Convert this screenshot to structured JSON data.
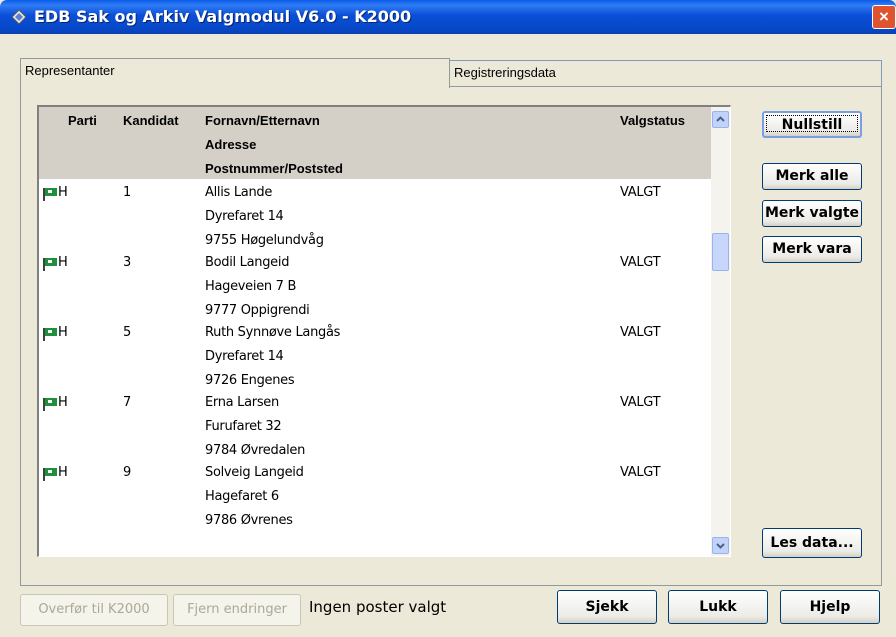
{
  "window": {
    "title": "EDB Sak og Arkiv Valgmodul V6.0 - K2000",
    "close_glyph": "×"
  },
  "tabs": [
    {
      "label": "Representanter",
      "active": true
    },
    {
      "label": "Registreringsdata",
      "active": false
    }
  ],
  "list": {
    "columns": {
      "parti": "Parti",
      "kandidat": "Kandidat",
      "name": "Fornavn/Etternavn",
      "address": "Adresse",
      "postal": "Postnummer/Poststed",
      "status": "Valgstatus"
    },
    "rows": [
      {
        "parti": "H",
        "kandidat": "1",
        "name": "Allis Lande",
        "address": "Dyrefaret 14",
        "postal": "9755 Høgelundvåg",
        "status": "VALGT"
      },
      {
        "parti": "H",
        "kandidat": "3",
        "name": "Bodil Langeid",
        "address": "Hageveien 7 B",
        "postal": "9777 Oppigrendi",
        "status": "VALGT"
      },
      {
        "parti": "H",
        "kandidat": "5",
        "name": "Ruth Synnøve Langås",
        "address": "Dyrefaret 14",
        "postal": "9726 Engenes",
        "status": "VALGT"
      },
      {
        "parti": "H",
        "kandidat": "7",
        "name": "Erna Larsen",
        "address": "Furufaret 32",
        "postal": "9784 Øvredalen",
        "status": "VALGT"
      },
      {
        "parti": "H",
        "kandidat": "9",
        "name": "Solveig Langeid",
        "address": "Hagefaret 6",
        "postal": "9786 Øvrenes",
        "status": "VALGT"
      }
    ]
  },
  "side_buttons": {
    "nullstill": "Nullstill",
    "merk_alle": "Merk alle",
    "merk_valgte": "Merk valgte",
    "merk_vara": "Merk vara",
    "les_data": "Les data..."
  },
  "bottom": {
    "overfor": "Overfør til K2000",
    "fjern": "Fjern endringer",
    "status": "Ingen poster valgt",
    "sjekk": "Sjekk",
    "lukk": "Lukk",
    "hjelp": "Hjelp"
  },
  "colors": {
    "titlebar": "#0A4FD6",
    "face": "#ECE9D8",
    "flag": "#1E8F3A"
  }
}
